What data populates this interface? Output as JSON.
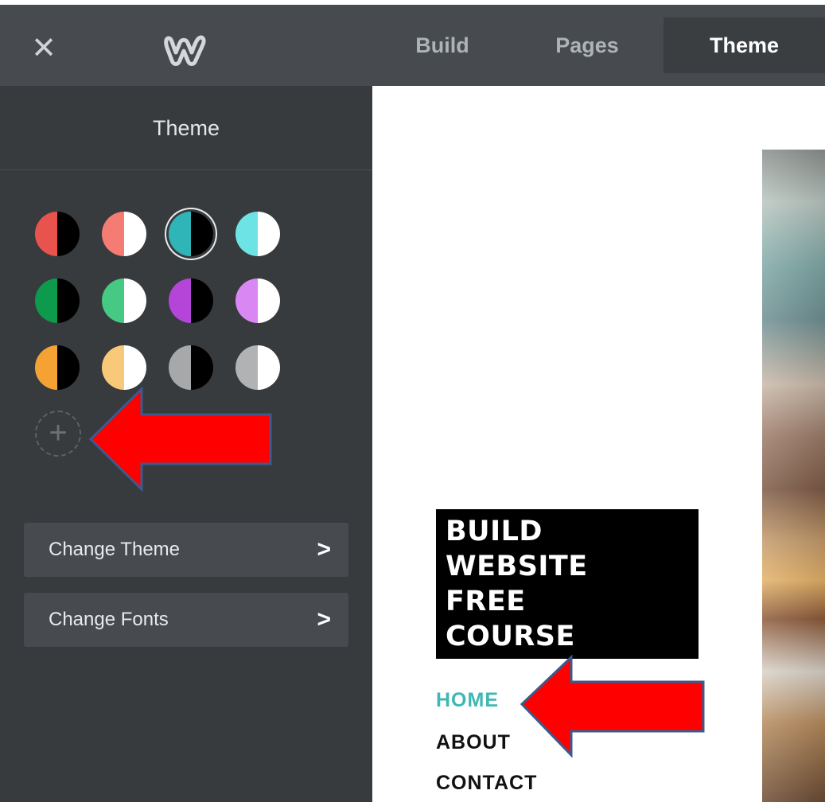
{
  "topbar": {
    "close_glyph": "✕",
    "tabs": [
      {
        "label": "Build",
        "active": false
      },
      {
        "label": "Pages",
        "active": false
      },
      {
        "label": "Theme",
        "active": true
      }
    ]
  },
  "sidebar": {
    "title": "Theme",
    "swatches": [
      {
        "name": "red-dark",
        "left": "#e8534d",
        "right": "#000000",
        "selected": false
      },
      {
        "name": "salmon-light",
        "left": "#f47c73",
        "right": "#ffffff",
        "selected": false
      },
      {
        "name": "teal-dark",
        "left": "#2fb5b8",
        "right": "#000000",
        "selected": true
      },
      {
        "name": "aqua-light",
        "left": "#6ee3e6",
        "right": "#ffffff",
        "selected": false
      },
      {
        "name": "green-dark",
        "left": "#0e9a4d",
        "right": "#000000",
        "selected": false
      },
      {
        "name": "mint-light",
        "left": "#45c983",
        "right": "#ffffff",
        "selected": false
      },
      {
        "name": "purple-dark",
        "left": "#b545d8",
        "right": "#000000",
        "selected": false
      },
      {
        "name": "lilac-light",
        "left": "#d987f2",
        "right": "#ffffff",
        "selected": false
      },
      {
        "name": "orange-dark",
        "left": "#f5a234",
        "right": "#000000",
        "selected": false
      },
      {
        "name": "peach-light",
        "left": "#f9c97a",
        "right": "#ffffff",
        "selected": false
      },
      {
        "name": "gray-dark",
        "left": "#a6a8aa",
        "right": "#000000",
        "selected": false
      },
      {
        "name": "gray-light",
        "left": "#b0b2b4",
        "right": "#ffffff",
        "selected": false
      }
    ],
    "add_swatch_glyph": "+",
    "change_theme_label": "Change Theme",
    "change_fonts_label": "Change Fonts",
    "chevron_glyph": ">"
  },
  "canvas": {
    "site_title_lines": [
      "BUILD",
      "WEBSITE",
      "FREE",
      "COURSE"
    ],
    "nav": [
      {
        "label": "HOME",
        "active": true
      },
      {
        "label": "ABOUT",
        "active": false
      },
      {
        "label": "CONTACT",
        "active": false
      }
    ]
  },
  "colors": {
    "topbar_bg": "#474b4f",
    "sidebar_bg": "#373b3e",
    "accent": "#3fb7b4",
    "arrow_red": "#ff0000",
    "arrow_outline": "#3c5a8c"
  }
}
